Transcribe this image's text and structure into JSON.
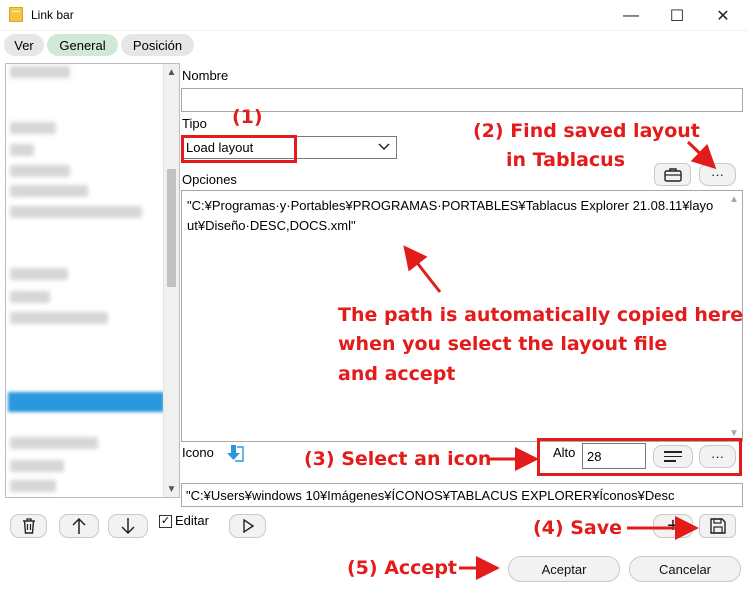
{
  "window": {
    "title": "Link bar",
    "minimize_glyph": "—",
    "maximize_glyph": "☐",
    "close_glyph": "✕"
  },
  "tabs": [
    {
      "label": "Ver"
    },
    {
      "label": "General"
    },
    {
      "label": "Posición"
    }
  ],
  "form": {
    "nombre_label": "Nombre",
    "nombre_value": "",
    "tipo_label": "Tipo",
    "tipo_value": "Load layout",
    "opciones_label": "Opciones",
    "opciones_value": "\"C:¥Programas·y·Portables¥PROGRAMAS·PORTABLES¥Tablacus Explorer 21.08.11¥layout¥Diseño·DESC,DOCS.xml\"",
    "icono_label": "Icono",
    "alto_label": "Alto",
    "alto_value": "28",
    "icon_path_value": "\"C:¥Users¥windows 10¥Imágenes¥ÍCONOS¥TABLACUS EXPLORER¥Íconos¥Desc",
    "editar_label": "Editar",
    "editar_checked_glyph": "✓"
  },
  "buttons": {
    "more_label": "···",
    "add_glyph": "+",
    "aceptar_label": "Aceptar",
    "cancelar_label": "Cancelar"
  },
  "annotations": {
    "step1": "(1)",
    "step2_line1": "(2)  Find saved layout",
    "step2_line2": "in Tablacus",
    "path_note_line1": "The path is automatically copied here",
    "path_note_line2": "when you select  the layout file",
    "path_note_line3": "and accept",
    "step3": "(3) Select an icon",
    "step4": "(4) Save",
    "step5": "(5) Accept",
    "color": "#e31b1b"
  },
  "colors": {
    "tab_active": "#cfe9d6",
    "tab_inactive": "#e6e6e6",
    "selection": "#2a98dc"
  }
}
